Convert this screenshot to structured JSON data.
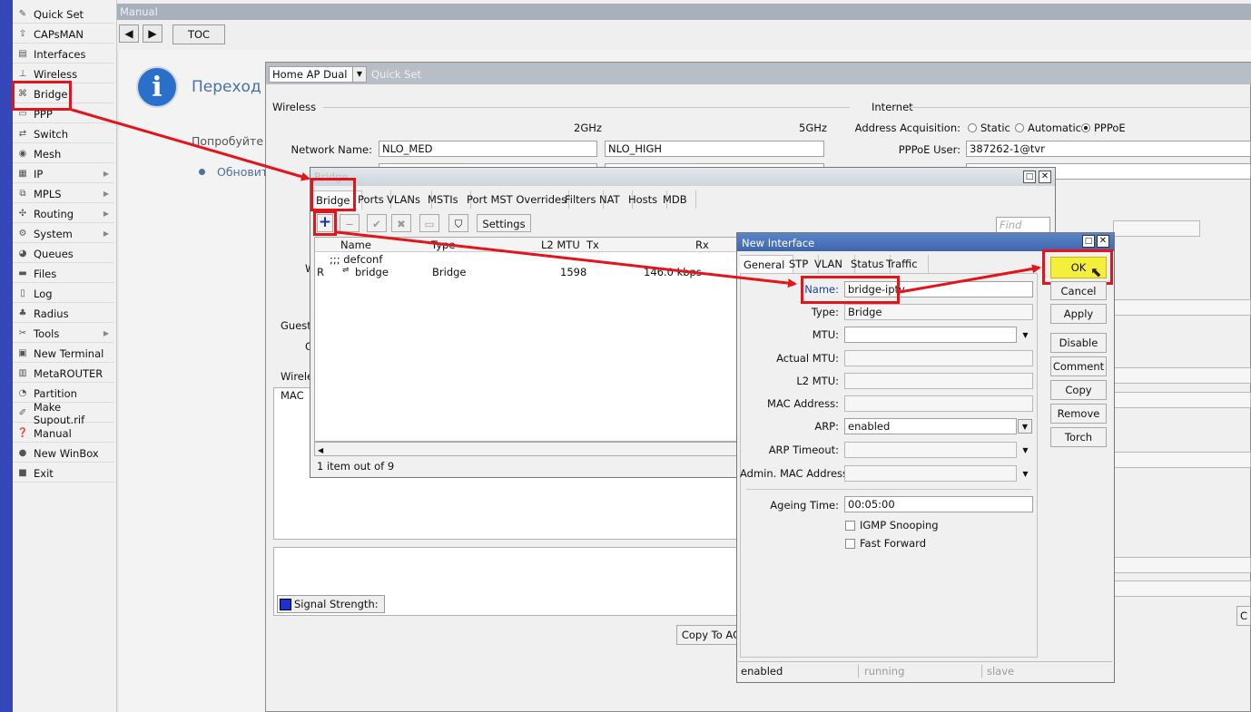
{
  "sidebar": {
    "items": [
      {
        "label": "Quick Set",
        "icon": "quick-set-icon",
        "arrow": false
      },
      {
        "label": "CAPsMAN",
        "icon": "capsman-icon",
        "arrow": false
      },
      {
        "label": "Interfaces",
        "icon": "interfaces-icon",
        "arrow": false
      },
      {
        "label": "Wireless",
        "icon": "wireless-icon",
        "arrow": false
      },
      {
        "label": "Bridge",
        "icon": "bridge-icon",
        "arrow": false
      },
      {
        "label": "PPP",
        "icon": "ppp-icon",
        "arrow": false
      },
      {
        "label": "Switch",
        "icon": "switch-icon",
        "arrow": false
      },
      {
        "label": "Mesh",
        "icon": "mesh-icon",
        "arrow": false
      },
      {
        "label": "IP",
        "icon": "ip-icon",
        "arrow": true
      },
      {
        "label": "MPLS",
        "icon": "mpls-icon",
        "arrow": true
      },
      {
        "label": "Routing",
        "icon": "routing-icon",
        "arrow": true
      },
      {
        "label": "System",
        "icon": "system-icon",
        "arrow": true
      },
      {
        "label": "Queues",
        "icon": "queues-icon",
        "arrow": false
      },
      {
        "label": "Files",
        "icon": "files-icon",
        "arrow": false
      },
      {
        "label": "Log",
        "icon": "log-icon",
        "arrow": false
      },
      {
        "label": "Radius",
        "icon": "radius-icon",
        "arrow": false
      },
      {
        "label": "Tools",
        "icon": "tools-icon",
        "arrow": true
      },
      {
        "label": "New Terminal",
        "icon": "terminal-icon",
        "arrow": false
      },
      {
        "label": "MetaROUTER",
        "icon": "metarouter-icon",
        "arrow": false
      },
      {
        "label": "Partition",
        "icon": "partition-icon",
        "arrow": false
      },
      {
        "label": "Make Supout.rif",
        "icon": "supout-icon",
        "arrow": false
      },
      {
        "label": "Manual",
        "icon": "manual-icon",
        "arrow": false
      },
      {
        "label": "New WinBox",
        "icon": "winbox-icon",
        "arrow": false
      },
      {
        "label": "Exit",
        "icon": "exit-icon",
        "arrow": false
      }
    ]
  },
  "manual": {
    "title": "Manual",
    "toc_label": "TOC",
    "heading": "Переход н",
    "try_text": "Попробуйте",
    "bullet_text": "Обновит"
  },
  "quickset": {
    "mode": "Home AP Dual",
    "title": "Quick Set",
    "wireless_section": "Wireless",
    "col_2ghz": "2GHz",
    "col_5ghz": "5GHz",
    "network_name_label": "Network Name:",
    "network_name_2g": "NLO_MED",
    "network_name_5g": "NLO_HIGH",
    "internet_section": "Internet",
    "address_acquisition_label": "Address Acquisition:",
    "opt_static": "Static",
    "opt_automatic": "Automatic",
    "opt_pppoe": "PPPoE",
    "pppoe_user_label": "PPPoE User:",
    "pppoe_user": "387262-1@tvr",
    "guest_label": "Guest",
    "wireless_clients_label": "Wireles",
    "mac_col": "MAC",
    "signal_strength": "Signal Strength:",
    "copy_button": "Copy To AC",
    "right_edge_button": "C",
    "letter_w": "W",
    "letter_c": "C"
  },
  "bridge_window": {
    "title": "Bridge",
    "tabs": [
      "Bridge",
      "Ports",
      "VLANs",
      "MSTIs",
      "Port MST Overrides",
      "Filters",
      "NAT",
      "Hosts",
      "MDB"
    ],
    "settings_label": "Settings",
    "find_placeholder": "Find",
    "columns": [
      "Name",
      "Type",
      "L2 MTU",
      "Tx",
      "Rx"
    ],
    "comment_row": ";;; defconf",
    "rows": [
      {
        "flag": "R",
        "name": "bridge",
        "type": "Bridge",
        "l2mtu": "1598",
        "tx": "146.0 kbps",
        "rx": ""
      }
    ],
    "status": "1 item out of 9"
  },
  "new_interface": {
    "title": "New Interface",
    "tabs": [
      "General",
      "STP",
      "VLAN",
      "Status",
      "Traffic"
    ],
    "fields": {
      "name_label": "Name:",
      "name_value": "bridge-iptv",
      "type_label": "Type:",
      "type_value": "Bridge",
      "mtu_label": "MTU:",
      "mtu_value": "",
      "actual_mtu_label": "Actual MTU:",
      "actual_mtu_value": "",
      "l2mtu_label": "L2 MTU:",
      "l2mtu_value": "",
      "mac_label": "MAC Address:",
      "mac_value": "",
      "arp_label": "ARP:",
      "arp_value": "enabled",
      "arp_timeout_label": "ARP Timeout:",
      "arp_timeout_value": "",
      "admin_mac_label": "Admin. MAC Address:",
      "admin_mac_value": "",
      "ageing_label": "Ageing Time:",
      "ageing_value": "00:05:00",
      "igmp_label": "IGMP Snooping",
      "fastfwd_label": "Fast Forward"
    },
    "buttons": {
      "ok": "OK",
      "cancel": "Cancel",
      "apply": "Apply",
      "disable": "Disable",
      "comment": "Comment",
      "copy": "Copy",
      "remove": "Remove",
      "torch": "Torch"
    },
    "status": {
      "enabled": "enabled",
      "running": "running",
      "slave": "slave"
    }
  },
  "colors": {
    "annotation_red": "#e3141b",
    "ok_highlight": "#f4ef3a",
    "accent_blue": "#3347b8",
    "signal_swatch": "#1f2fd6"
  }
}
